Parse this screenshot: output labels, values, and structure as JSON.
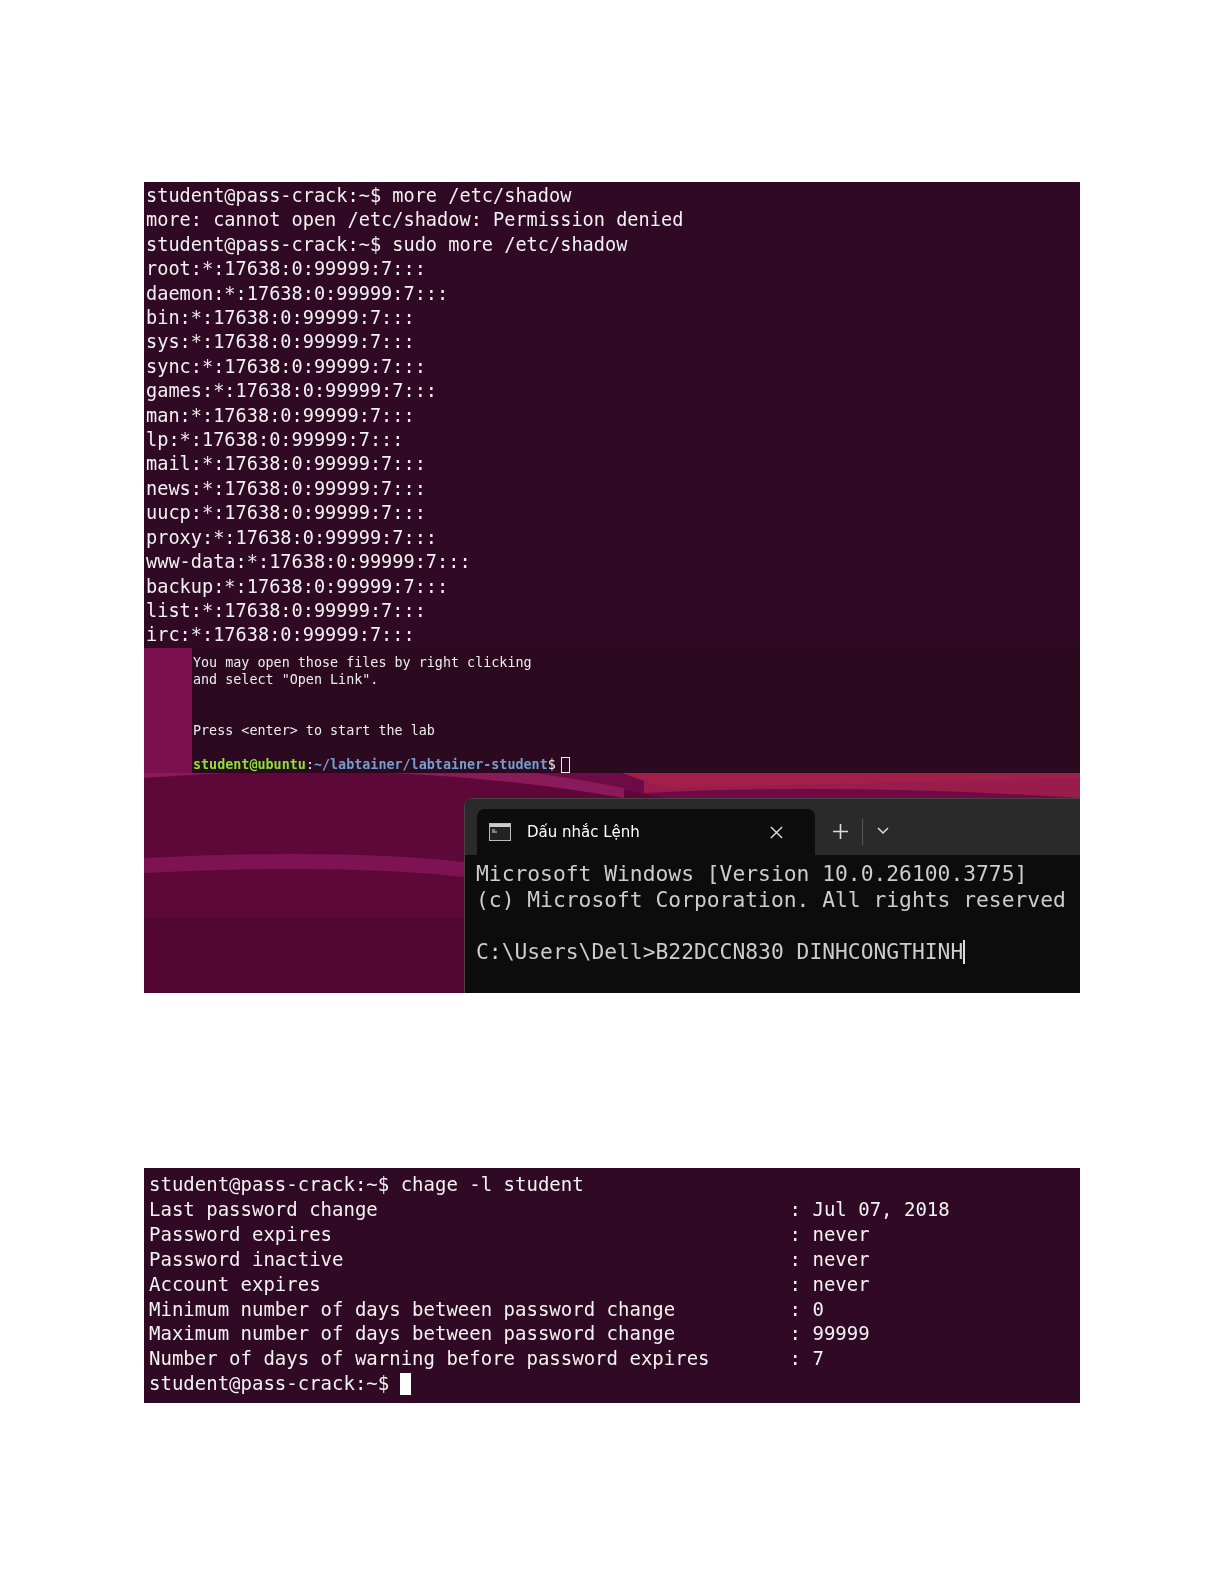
{
  "shadow_terminal": {
    "lines": [
      "student@pass-crack:~$ more /etc/shadow",
      "more: cannot open /etc/shadow: Permission denied",
      "student@pass-crack:~$ sudo more /etc/shadow",
      "root:*:17638:0:99999:7:::",
      "daemon:*:17638:0:99999:7:::",
      "bin:*:17638:0:99999:7:::",
      "sys:*:17638:0:99999:7:::",
      "sync:*:17638:0:99999:7:::",
      "games:*:17638:0:99999:7:::",
      "man:*:17638:0:99999:7:::",
      "lp:*:17638:0:99999:7:::",
      "mail:*:17638:0:99999:7:::",
      "news:*:17638:0:99999:7:::",
      "uucp:*:17638:0:99999:7:::",
      "proxy:*:17638:0:99999:7:::",
      "www-data:*:17638:0:99999:7:::",
      "backup:*:17638:0:99999:7:::",
      "list:*:17638:0:99999:7:::",
      "irc:*:17638:0:99999:7:::"
    ]
  },
  "lab_terminal": {
    "paragraphs": [
      [
        "You may open those files by right clicking",
        "and select \"Open Link\"."
      ],
      [
        "Press <enter> to start the lab"
      ]
    ],
    "prompt": {
      "user_host": "student@ubuntu",
      "separator": ":",
      "path": "~/labtainer/labtainer-student",
      "symbol": "$",
      "cursor_focused": false
    }
  },
  "cmd_window": {
    "tab": {
      "title": "Dấu nhắc Lệnh",
      "selected": true
    },
    "lines": [
      "Microsoft Windows [Version 10.0.26100.3775]",
      "(c) Microsoft Corporation. All rights reserved"
    ],
    "prompt": "C:\\Users\\Dell>",
    "input": "B22DCCN830 DINHCONGTHINH",
    "cursor_focused": true
  },
  "chage_terminal": {
    "command": "student@pass-crack:~$ chage -l student",
    "rows": [
      {
        "label": "Last password change",
        "value": ": Jul 07, 2018"
      },
      {
        "label": "Password expires",
        "value": ": never"
      },
      {
        "label": "Password inactive",
        "value": ": never"
      },
      {
        "label": "Account expires",
        "value": ": never"
      },
      {
        "label": "Minimum number of days between password change",
        "value": ": 0"
      },
      {
        "label": "Maximum number of days between password change",
        "value": ": 99999"
      },
      {
        "label": "Number of days of warning before password expires",
        "value": ": 7"
      }
    ],
    "prompt": "student@pass-crack:~$",
    "cursor_focused": true
  }
}
